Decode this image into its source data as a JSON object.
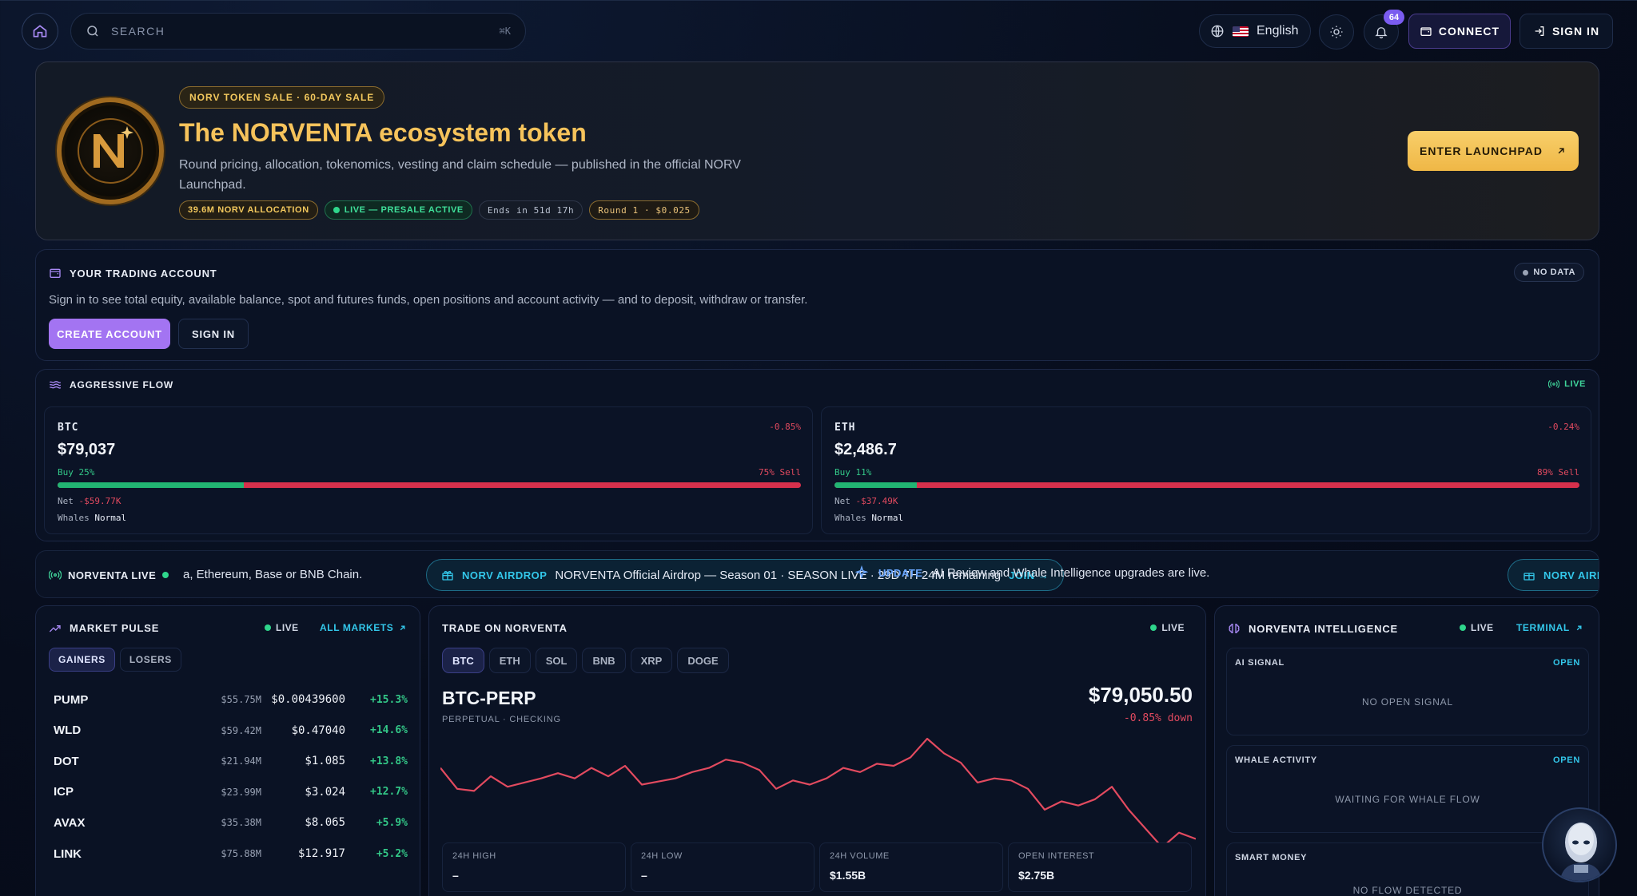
{
  "topbar": {
    "search_placeholder": "SEARCH",
    "search_shortcut": "⌘K",
    "language": "English",
    "notifications_count": "64",
    "connect_label": "CONNECT",
    "signin_label": "SIGN IN"
  },
  "hero": {
    "pill": "NORV TOKEN SALE · 60-DAY SALE",
    "title": "The NORVENTA ecosystem token",
    "description": "Round pricing, allocation, tokenomics, vesting and claim schedule — published in the official NORV Launchpad.",
    "tags": {
      "allocation": "39.6M NORV ALLOCATION",
      "live": "LIVE — PRESALE ACTIVE",
      "ends": "Ends in 51d 17h",
      "round": "Round 1 · $0.025"
    },
    "cta": "ENTER LAUNCHPAD",
    "logo_letter": "N"
  },
  "account": {
    "title": "YOUR TRADING ACCOUNT",
    "status": "NO DATA",
    "description": "Sign in to see total equity, available balance, spot and futures funds, open positions and account activity — and to deposit, withdraw or transfer.",
    "create_label": "CREATE ACCOUNT",
    "signin_label": "SIGN IN"
  },
  "flow": {
    "title": "AGGRESSIVE FLOW",
    "live": "LIVE",
    "net_label": "Net",
    "whales_label": "Whales",
    "items": [
      {
        "symbol": "BTC",
        "change": "-0.85%",
        "price": "$79,037",
        "buy": "Buy 25%",
        "sell": "75% Sell",
        "buy_pct": 25,
        "net": "-$59.77K",
        "whales": "Normal"
      },
      {
        "symbol": "ETH",
        "change": "-0.24%",
        "price": "$2,486.7",
        "buy": "Buy 11%",
        "sell": "89% Sell",
        "buy_pct": 11,
        "net": "-$37.49K",
        "whales": "Normal"
      }
    ]
  },
  "ticker": {
    "label": "NORVENTA LIVE",
    "fragment": "a, Ethereum, Base or BNB Chain.",
    "airdrop_tag": "NORV AIRDROP",
    "airdrop_text": "NORVENTA Official Airdrop — Season 01 · SEASON LIVE · 29D 7H 24M remaining",
    "airdrop_join": "JOIN →",
    "update_tag": "UPDATE",
    "update_text": "AI Review and Whale Intelligence upgrades are live.",
    "airdrop_tag_2": "NORV AIRDRO"
  },
  "pulse": {
    "title": "MARKET PULSE",
    "live": "LIVE",
    "link": "ALL MARKETS",
    "tabs": [
      "GAINERS",
      "LOSERS"
    ],
    "rows": [
      {
        "symbol": "PUMP",
        "volume": "$55.75M",
        "price": "$0.00439600",
        "change": "+15.3%"
      },
      {
        "symbol": "WLD",
        "volume": "$59.42M",
        "price": "$0.47040",
        "change": "+14.6%"
      },
      {
        "symbol": "DOT",
        "volume": "$21.94M",
        "price": "$1.085",
        "change": "+13.8%"
      },
      {
        "symbol": "ICP",
        "volume": "$23.99M",
        "price": "$3.024",
        "change": "+12.7%"
      },
      {
        "symbol": "AVAX",
        "volume": "$35.38M",
        "price": "$8.065",
        "change": "+5.9%"
      },
      {
        "symbol": "LINK",
        "volume": "$75.88M",
        "price": "$12.917",
        "change": "+5.2%"
      }
    ]
  },
  "trade": {
    "title": "TRADE ON NORVENTA",
    "live": "LIVE",
    "coins": [
      "BTC",
      "ETH",
      "SOL",
      "BNB",
      "XRP",
      "DOGE"
    ],
    "pair": "BTC-PERP",
    "pair_sub": "PERPETUAL · CHECKING",
    "price": "$79,050.50",
    "change": "-0.85% down",
    "series": [
      79080,
      79060,
      79058,
      79072,
      79062,
      79066,
      79070,
      79075,
      79070,
      79080,
      79072,
      79082,
      79064,
      79067,
      79070,
      79076,
      79080,
      79088,
      79085,
      79078,
      79060,
      79068,
      79064,
      79070,
      79080,
      79076,
      79084,
      79082,
      79090,
      79108,
      79094,
      79085,
      79066,
      79070,
      79068,
      79060,
      79040,
      79048,
      79044,
      79050,
      79062,
      79040,
      79022,
      79004,
      79018,
      79012
    ],
    "stats": [
      {
        "label": "24H HIGH",
        "value": "–"
      },
      {
        "label": "24H LOW",
        "value": "–"
      },
      {
        "label": "24H VOLUME",
        "value": "$1.55B"
      },
      {
        "label": "OPEN INTEREST",
        "value": "$2.75B"
      }
    ]
  },
  "intel": {
    "title": "NORVENTA INTELLIGENCE",
    "live": "LIVE",
    "link": "TERMINAL",
    "boxes": [
      {
        "title": "AI SIGNAL",
        "action": "OPEN",
        "message": "NO OPEN SIGNAL"
      },
      {
        "title": "WHALE ACTIVITY",
        "action": "OPEN",
        "message": "WAITING FOR WHALE FLOW"
      },
      {
        "title": "SMART MONEY",
        "action": "",
        "message": "NO FLOW DETECTED"
      }
    ]
  },
  "colors": {
    "accent_gold": "#f6c35b",
    "accent_purple": "#a374f2",
    "accent_cyan": "#33c7ea",
    "up": "#33c888",
    "down": "#e24a5f"
  }
}
